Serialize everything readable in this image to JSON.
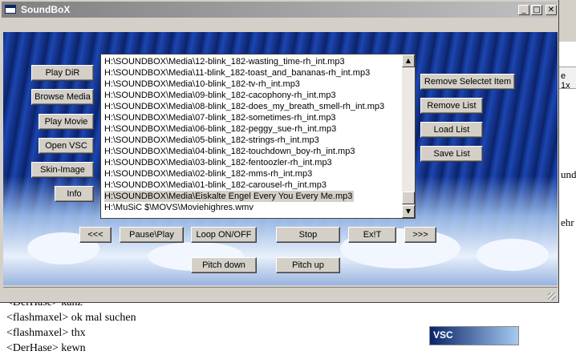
{
  "window": {
    "title": "SoundBoX"
  },
  "left_buttons": [
    {
      "label": "Play DiR"
    },
    {
      "label": "Browse Media"
    },
    {
      "label": "Play Movie"
    },
    {
      "label": "Open VSC"
    },
    {
      "label": "Skin-Image"
    },
    {
      "label": "Info"
    }
  ],
  "right_buttons": [
    {
      "label": "Remove Selectet Item"
    },
    {
      "label": "Remove List"
    },
    {
      "label": "Load List"
    },
    {
      "label": "Save List"
    }
  ],
  "playlist": {
    "selected_index": 13,
    "items": [
      "H:\\SOUNDBOX\\Media\\12-blink_182-wasting_time-rh_int.mp3",
      "H:\\SOUNDBOX\\Media\\11-blink_182-toast_and_bananas-rh_int.mp3",
      "H:\\SOUNDBOX\\Media\\10-blink_182-tv-rh_int.mp3",
      "H:\\SOUNDBOX\\Media\\09-blink_182-cacophony-rh_int.mp3",
      "H:\\SOUNDBOX\\Media\\08-blink_182-does_my_breath_smell-rh_int.mp3",
      "H:\\SOUNDBOX\\Media\\07-blink_182-sometimes-rh_int.mp3",
      "H:\\SOUNDBOX\\Media\\06-blink_182-peggy_sue-rh_int.mp3",
      "H:\\SOUNDBOX\\Media\\05-blink_182-strings-rh_int.mp3",
      "H:\\SOUNDBOX\\Media\\04-blink_182-touchdown_boy-rh_int.mp3",
      "H:\\SOUNDBOX\\Media\\03-blink_182-fentoozler-rh_int.mp3",
      "H:\\SOUNDBOX\\Media\\02-blink_182-mms-rh_int.mp3",
      "H:\\SOUNDBOX\\Media\\01-blink_182-carousel-rh_int.mp3",
      "H:\\SOUNDBOX\\Media\\Eiskalte Engel Every You Every Me.mp3",
      "H:\\MuSiC $\\MOVS\\Moviehighres.wmv"
    ]
  },
  "transport": {
    "prev": "<<<",
    "pause_play": "Pause\\Play",
    "loop": "Loop ON/OFF",
    "stop": "Stop",
    "exit": "Ex!T",
    "next": ">>>"
  },
  "pitch": {
    "down": "Pitch down",
    "up": "Pitch up"
  },
  "background_chat": {
    "lines": [
      "<DerHase> kanz",
      "<flashmaxel> ok mal suchen",
      "<flashmaxel> thx",
      "<DerHase> kewn"
    ],
    "tab_fragment": "e 1x",
    "fragment_1": "und",
    "fragment_2": "ehr",
    "vsc_label": "VSC"
  }
}
